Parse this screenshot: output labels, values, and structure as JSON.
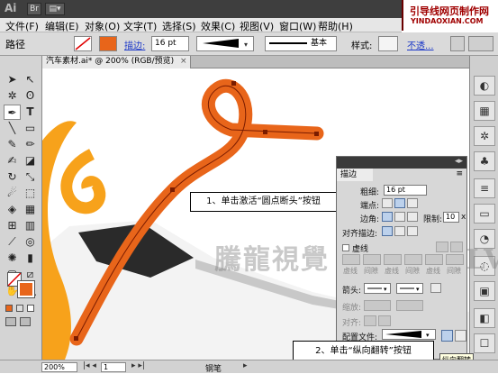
{
  "app": {
    "logo": "Ai",
    "top_right_label": "基"
  },
  "brand": {
    "name_cn": "引导线网页制作网",
    "name_en": "YINDAOXIAN.COM"
  },
  "menu": [
    "文件(F)",
    "编辑(E)",
    "对象(O)",
    "文字(T)",
    "选择(S)",
    "效果(C)",
    "视图(V)",
    "窗口(W)",
    "帮助(H)"
  ],
  "control": {
    "mode_label": "路径",
    "stroke_label": "描边:",
    "stroke_value": "16 pt",
    "style_preset": "基本",
    "style_label": "样式:",
    "opacity_link": "不透..."
  },
  "document": {
    "tab_title": "汽车素材.ai* @ 200% (RGB/预览)",
    "tab_close": "×"
  },
  "stroke_panel": {
    "title": "描边",
    "weight_label": "粗细:",
    "weight_value": "16 pt",
    "cap_label": "端点:",
    "corner_label": "边角:",
    "miter_label": "限制:",
    "miter_value": "10",
    "miter_unit": "x",
    "align_label": "对齐描边:",
    "dashed_label": "虚线",
    "dash_headers": [
      "虚线",
      "间隙",
      "虚线",
      "间隙",
      "虚线",
      "间隙"
    ],
    "arrow_label": "箭头:",
    "scale_label": "缩放:",
    "align_arrow_label": "对齐:",
    "profile_label": "配置文件:"
  },
  "callouts": {
    "first": "1、单击激活“圆点断头”按钮",
    "second": "2、单击“纵向翻转”按钮"
  },
  "tooltip": "纵向翻转",
  "watermark": "騰龍視覺 WWW.TLVI.NET",
  "status": {
    "zoom": "200%",
    "page": "1",
    "tool": "钢笔"
  },
  "colors": {
    "stroke_orange": "#e8651a",
    "accent_yellow": "#f5a623",
    "callout_border": "#000000"
  }
}
